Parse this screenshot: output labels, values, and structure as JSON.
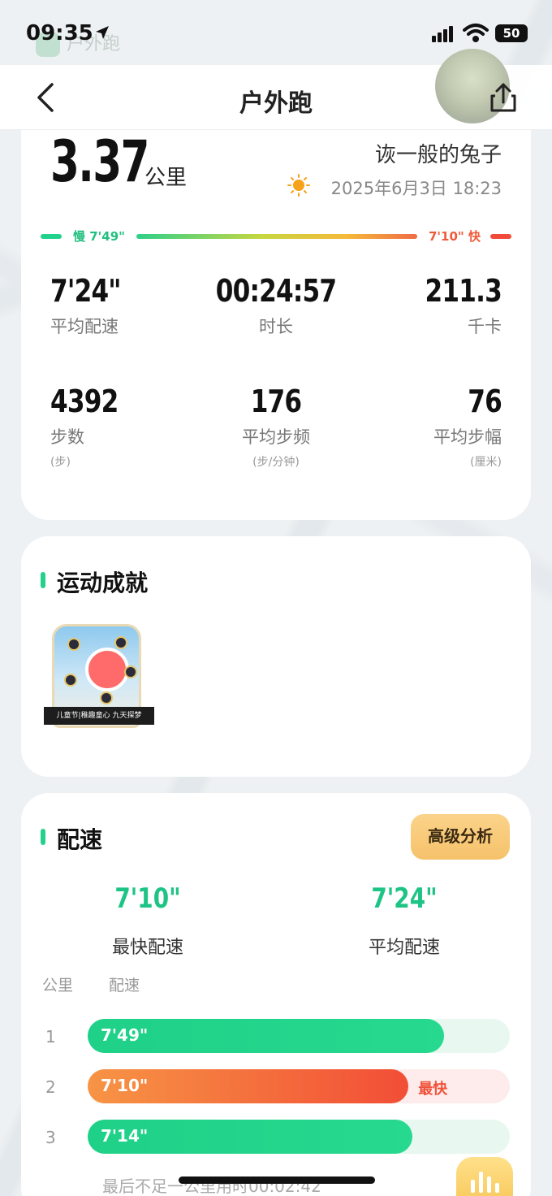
{
  "status_bar": {
    "time": "09:35",
    "battery": "50",
    "ghost_app_label": "户外跑"
  },
  "nav": {
    "title": "户外跑"
  },
  "summary": {
    "distance": "3.37",
    "distance_unit": "公里",
    "username": "诙一般的兔子",
    "date": "2025年6月3日 18:23",
    "pace_legend": {
      "slow": "慢 7'49\"",
      "fast": "7'10\" 快"
    },
    "metrics_row1": [
      {
        "value": "7'24\"",
        "label": "平均配速"
      },
      {
        "value": "00:24:57",
        "label": "时长"
      },
      {
        "value": "211.3",
        "label": "千卡"
      }
    ],
    "metrics_row2": [
      {
        "value": "4392",
        "label": "步数",
        "unit": "(步)"
      },
      {
        "value": "176",
        "label": "平均步频",
        "unit": "(步/分钟)"
      },
      {
        "value": "76",
        "label": "平均步幅",
        "unit": "(厘米)"
      }
    ]
  },
  "achievements": {
    "title": "运动成就",
    "badge_caption": "儿童节|稚趣童心 九天探梦"
  },
  "pace": {
    "title": "配速",
    "advanced_button": "高级分析",
    "fastest": {
      "value": "7'10\"",
      "label": "最快配速"
    },
    "average": {
      "value": "7'24\"",
      "label": "平均配速"
    },
    "col_km": "公里",
    "col_pace": "配速",
    "rows": [
      {
        "km": "1",
        "pace": "7'49\"",
        "fraction": 0.845,
        "fastest": false
      },
      {
        "km": "2",
        "pace": "7'10\"",
        "fraction": 0.76,
        "fastest": true,
        "tag": "最快"
      },
      {
        "km": "3",
        "pace": "7'14\"",
        "fraction": 0.77,
        "fastest": false
      }
    ],
    "footnote": "最后不足一公里用时00:02:42"
  },
  "colors": {
    "accent_green": "#22d18b",
    "fast_orange": "#f0523a",
    "button_gold": "#f6c26b"
  }
}
